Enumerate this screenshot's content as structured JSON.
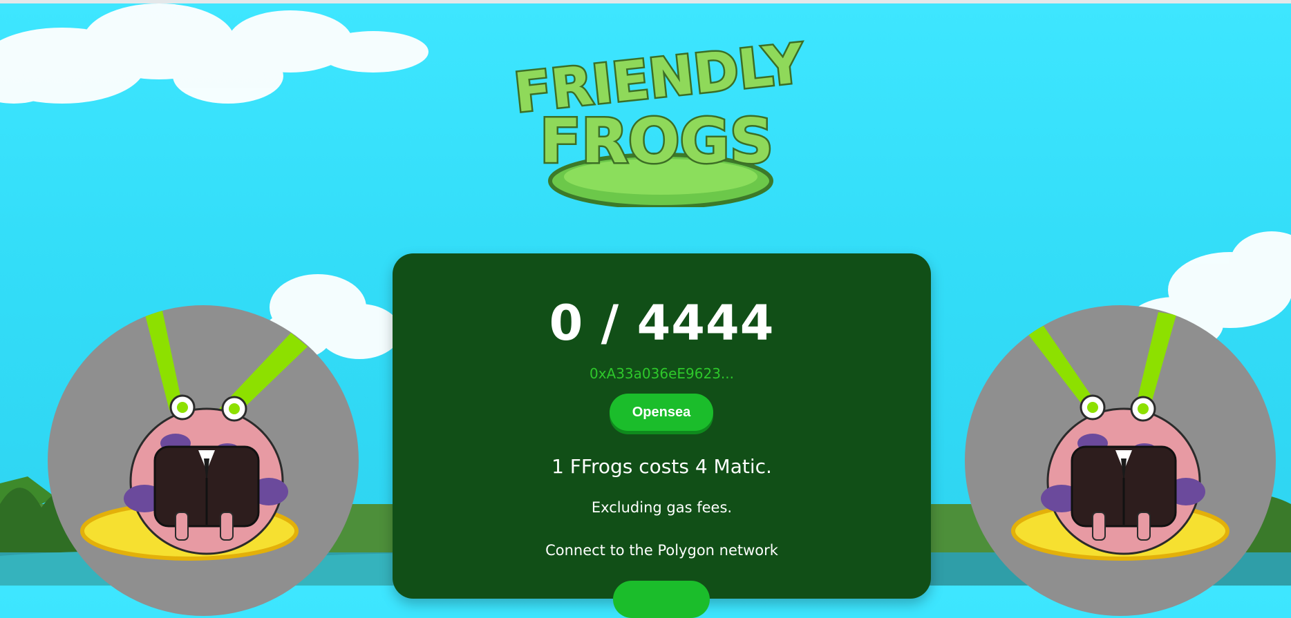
{
  "header": {
    "logo_line1": "FRIENDLY",
    "logo_line2": "FROGS"
  },
  "mint": {
    "count": "0 / 4444",
    "contract_address": "0xA33a036eE9623...",
    "opensea_label": "Opensea",
    "cost_text": "1 FFrogs costs 4 Matic.",
    "gas_note": "Excluding gas fees.",
    "network_note": "Connect to the Polygon network"
  },
  "colors": {
    "panel": "#114f17",
    "button": "#1bbd2b",
    "address": "#2ec82b",
    "sky": "#3ee6ff"
  },
  "icons": [
    "frog-nft-image-left",
    "frog-nft-image-right",
    "friendly-frogs-logo"
  ]
}
